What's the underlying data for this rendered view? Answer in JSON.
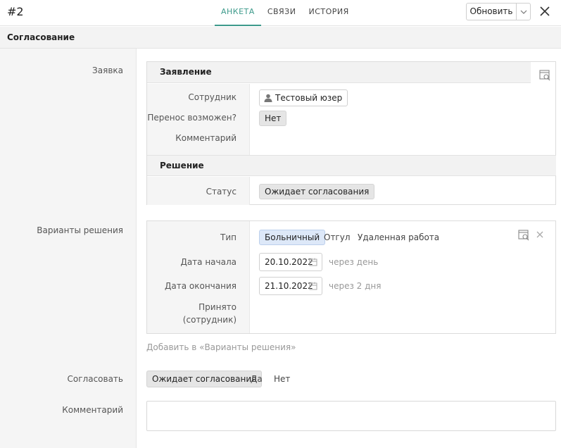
{
  "header": {
    "record_id": "#2",
    "tabs": [
      {
        "label": "АНКЕТА",
        "active": true
      },
      {
        "label": "СВЯЗИ",
        "active": false
      },
      {
        "label": "ИСТОРИЯ",
        "active": false
      }
    ],
    "refresh_label": "Обновить",
    "close_icon": "close-icon",
    "accent_color": "#3d9a8b"
  },
  "section": {
    "title": "Согласование"
  },
  "request": {
    "side_label": "Заявка",
    "statement_title": "Заявление",
    "employee_label": "Сотрудник",
    "employee_value": "Тестовый юзер",
    "transfer_label": "Перенос возможен?",
    "transfer_value": "Нет",
    "comment_label": "Комментарий",
    "decision_title": "Решение",
    "status_label": "Статус",
    "status_value": "Ожидает согласования"
  },
  "variants": {
    "side_label": "Варианты решения",
    "type_label": "Тип",
    "type_options": [
      "Больничный",
      "Отгул",
      "Удаленная работа"
    ],
    "type_selected": "Больничный",
    "start_label": "Дата начала",
    "start_value": "20.10.2022",
    "start_hint": "через день",
    "end_label": "Дата окончания",
    "end_value": "21.10.2022",
    "end_hint": "через 2 дня",
    "accepted_label_line1": "Принято",
    "accepted_label_line2": "(сотрудник)",
    "add_link": "Добавить в «Варианты решения»"
  },
  "approve": {
    "side_label": "Согласовать",
    "options": [
      "Ожидает согласования",
      "Да",
      "Нет"
    ],
    "selected": "Ожидает согласования"
  },
  "comment": {
    "side_label": "Комментарий",
    "value": ""
  }
}
